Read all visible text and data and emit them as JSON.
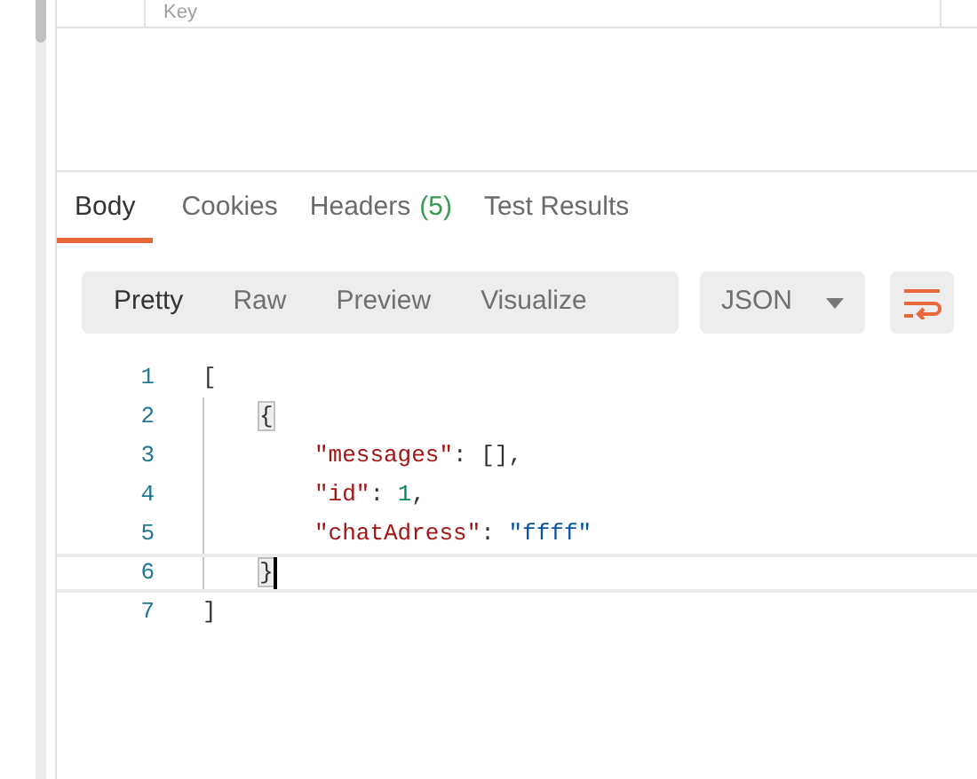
{
  "params_table": {
    "columns": [
      "Key"
    ]
  },
  "response_tabs": [
    {
      "label": "Body",
      "selected": true
    },
    {
      "label": "Cookies",
      "selected": false
    },
    {
      "label": "Headers",
      "count": "(5)",
      "selected": false
    },
    {
      "label": "Test Results",
      "selected": false
    }
  ],
  "view_modes": [
    {
      "label": "Pretty",
      "selected": true
    },
    {
      "label": "Raw",
      "selected": false
    },
    {
      "label": "Preview",
      "selected": false
    },
    {
      "label": "Visualize",
      "selected": false
    }
  ],
  "format_dropdown": {
    "value": "JSON"
  },
  "code": {
    "lines": [
      {
        "number": "1",
        "kind": "top",
        "current": false,
        "tokens": [
          {
            "kind": "punct",
            "text": "["
          }
        ]
      },
      {
        "number": "2",
        "kind": "object",
        "current": false,
        "tokens": [
          {
            "kind": "bracket_match",
            "text": "{"
          }
        ]
      },
      {
        "number": "3",
        "kind": "member",
        "current": false,
        "tokens": [
          {
            "kind": "key",
            "text": "\"messages\""
          },
          {
            "kind": "punct",
            "text": ": [],"
          }
        ]
      },
      {
        "number": "4",
        "kind": "member",
        "current": false,
        "tokens": [
          {
            "kind": "key",
            "text": "\"id\""
          },
          {
            "kind": "punct",
            "text": ": "
          },
          {
            "kind": "number",
            "text": "1"
          },
          {
            "kind": "punct",
            "text": ","
          }
        ]
      },
      {
        "number": "5",
        "kind": "member",
        "current": false,
        "tokens": [
          {
            "kind": "key",
            "text": "\"chatAdress\""
          },
          {
            "kind": "punct",
            "text": ": "
          },
          {
            "kind": "string",
            "text": "\"ffff\""
          }
        ]
      },
      {
        "number": "6",
        "kind": "object",
        "current": true,
        "tokens": [
          {
            "kind": "bracket_match",
            "text": "}"
          }
        ]
      },
      {
        "number": "7",
        "kind": "top",
        "current": false,
        "tokens": [
          {
            "kind": "punct",
            "text": "]"
          }
        ]
      }
    ]
  }
}
